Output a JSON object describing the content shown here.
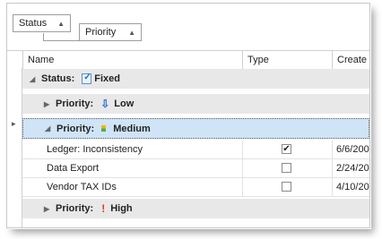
{
  "group_panel": {
    "chip1": "Status",
    "chip2": "Priority"
  },
  "columns": {
    "name": "Name",
    "type": "Type",
    "created": "Create"
  },
  "group_status": {
    "label": "Status:",
    "value": "Fixed"
  },
  "groups": [
    {
      "label": "Priority:",
      "value": "Low",
      "icon": "arrow-down-icon",
      "color": "#2d6fd3"
    },
    {
      "label": "Priority:",
      "value": "Medium",
      "icon": "medium-level-icon",
      "color": "#f0b400"
    },
    {
      "label": "Priority:",
      "value": "High",
      "icon": "exclamation-icon",
      "color": "#e33b1c"
    }
  ],
  "rows": [
    {
      "name": "Ledger: Inconsistency",
      "checked": true,
      "created": "6/6/200"
    },
    {
      "name": "Data Export",
      "checked": false,
      "created": "2/24/200"
    },
    {
      "name": "Vendor TAX IDs",
      "checked": false,
      "created": "4/10/200"
    }
  ],
  "row_indicator": "▸"
}
